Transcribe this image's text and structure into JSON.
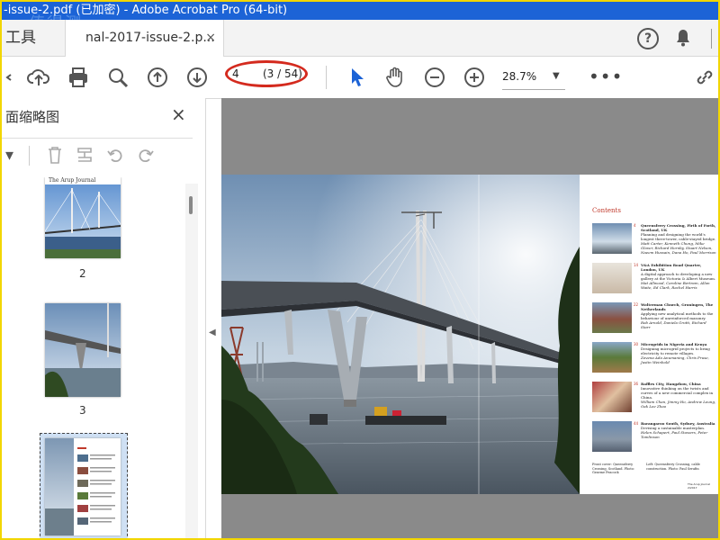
{
  "titlebar": {
    "text": "-issue-2.pdf  (已加密)  - Adobe Acrobat Pro (64-bit)",
    "watermark": "值得测"
  },
  "tabs": {
    "tools_label": "工具",
    "doc_label": "nal-2017-issue-2.p...",
    "close": "×"
  },
  "header_icons": [
    "help-icon",
    "bell-icon"
  ],
  "toolbar": {
    "page_input": "4",
    "page_count": "(3 / 54)",
    "zoom": "28.7%",
    "more": "•••",
    "icons": [
      "upload-icon",
      "print-icon",
      "search-zoom-icon",
      "prev-page-icon",
      "next-page-icon",
      "select-arrow-icon",
      "hand-icon",
      "zoom-out-icon",
      "zoom-in-icon",
      "share-link-icon"
    ]
  },
  "left_panel": {
    "title": "面缩略图",
    "close": "×",
    "tool_icons": [
      "options-icon",
      "delete-icon",
      "extract-icon",
      "undo-icon",
      "redo-icon"
    ],
    "thumbs": [
      {
        "num": "2",
        "header": "The Arup Journal"
      },
      {
        "num": "3"
      },
      {
        "num": ""
      }
    ]
  },
  "accent_color": "#1c63d6",
  "highlight_color": "#d42a1e",
  "document": {
    "contents_title": "Contents",
    "items": [
      {
        "num": "4",
        "title": "Queensferry Crossing, Firth of Forth, Scotland, UK",
        "desc": "Planning and designing the world's longest three-tower, cable-stayed bridge.",
        "authors": "Matt Carter, Kenneth Chung, Mike Glover, Richard Hornby, Stuart Nelson, Naeem Hussain, Dana Ho, Paul Morrison"
      },
      {
        "num": "14",
        "title": "V&A Exhibition Road Quarter, London, UK",
        "desc": "A digital approach to developing a new gallery at the Victoria & Albert Museum.",
        "authors": "Mat Allwood, Caroline Bertram, Allan Waite, Ed Clark, Rachel Harris"
      },
      {
        "num": "22",
        "title": "Wolterman Church, Groningen, The Netherlands",
        "desc": "Applying new analytical methods to the behaviour of unreinforced masonry.",
        "authors": "Rob Arnold, Daniela Grotti, Richard Starr"
      },
      {
        "num": "30",
        "title": "Microgrids in Nigeria and Kenya",
        "desc": "Designing microgrid projects to bring electricity to remote villages.",
        "authors": "Zovena Ada Anumaning, Chris Pruse, Justin Weinhold"
      },
      {
        "num": "36",
        "title": "Raffles City, Hangzhou, China",
        "desc": "Innovative thinking on the twists and curves of a new commercial complex in China.",
        "authors": "William Chan, Jimmy Ho, Andrew Leung, Oak Lee Zhao"
      },
      {
        "num": "44",
        "title": "Barangaroo South, Sydney, Australia",
        "desc": "Devising a sustainable masterplan.",
        "authors": "Helen Schapert, Paul Stowers, Peter Tomlinson"
      }
    ],
    "footer_left": "Front cover: Queensferry Crossing, Scotland. Photo: Graeme Peacock",
    "footer_right": "Left: Queensferry Crossing, cable construction. Photo: Paul Serafin",
    "footer_journal": "The Arup Journal 2/2017"
  }
}
